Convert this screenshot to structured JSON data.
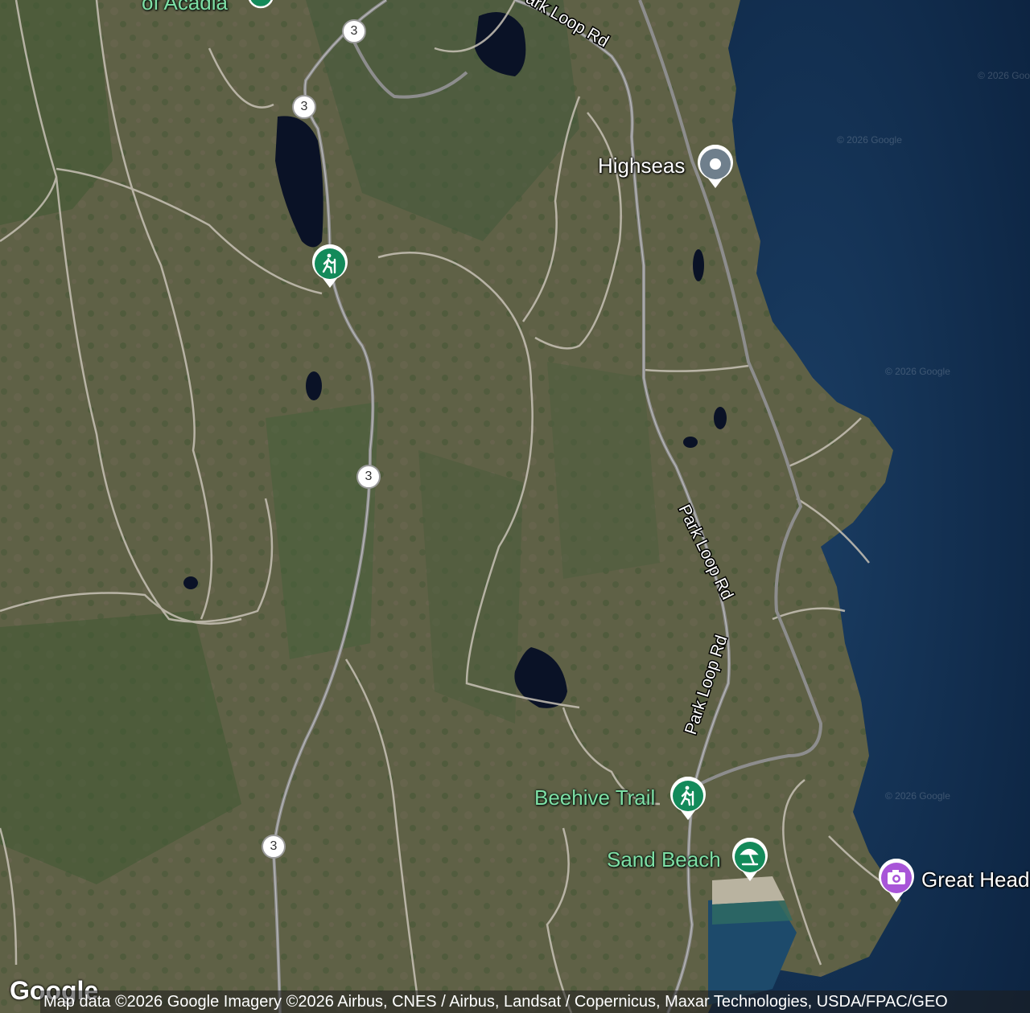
{
  "map": {
    "view": "satellite",
    "colors": {
      "land": "#5d6045",
      "ocean": "#0f2a4a",
      "lake": "#0b1428",
      "trail": "#c8c2b6",
      "road": "#9a9a9a",
      "marker_trail": "#138a5a",
      "marker_place": "#6f7f8c",
      "marker_photo": "#a855d8"
    }
  },
  "pois": [
    {
      "label": "of Acadia",
      "icon": "hiking-icon",
      "category": "trail",
      "partial": true
    },
    {
      "label": "Highseas",
      "icon": "place-pin-icon",
      "category": "place"
    },
    {
      "label": "",
      "icon": "hiking-icon",
      "category": "trail"
    },
    {
      "label": "Beehive Trail",
      "icon": "hiking-icon",
      "category": "trail"
    },
    {
      "label": "Sand Beach",
      "icon": "beach-icon",
      "category": "beach"
    },
    {
      "label": "Great Head",
      "icon": "camera-icon",
      "category": "photo",
      "partial": true
    }
  ],
  "roads": {
    "route_number": "3",
    "park_loop_label": "Park Loop Rd"
  },
  "watermark": "© 2026 Google",
  "attribution": "Map data ©2026 Google Imagery ©2026 Airbus, CNES / Airbus, Landsat / Copernicus, Maxar Technologies, USDA/FPAC/GEO",
  "logo": "Google"
}
